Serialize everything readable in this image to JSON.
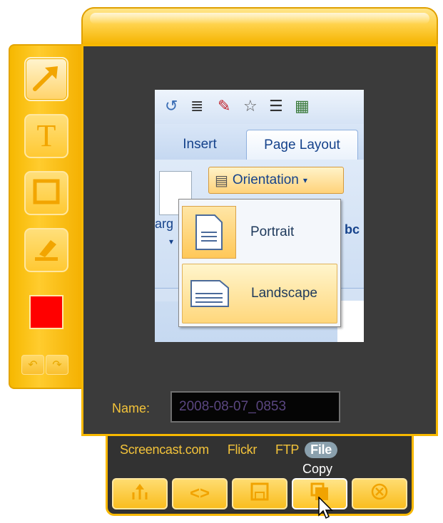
{
  "app": {
    "accent_color": "#f7b800",
    "panel_color": "#3b3b3b"
  },
  "tools": [
    {
      "name": "arrow",
      "icon": "arrow-icon",
      "active": true
    },
    {
      "name": "text",
      "icon": "text-icon",
      "glyph": "T",
      "active": false
    },
    {
      "name": "rectangle",
      "icon": "rectangle-icon",
      "active": false
    },
    {
      "name": "highlight",
      "icon": "highlighter-icon",
      "active": false
    }
  ],
  "current_color": "#ff0000",
  "preview": {
    "tabs": [
      "Insert",
      "Page Layout"
    ],
    "selected_tab": "Page Layout",
    "button_label": "Orientation",
    "partial_label": "arg",
    "partial_label_right": "bc",
    "menu_items": [
      {
        "label": "Portrait",
        "selected": true
      },
      {
        "label": "Landscape",
        "hovered": true
      }
    ]
  },
  "name_field": {
    "label": "Name:",
    "value": "2008-08-07_0853"
  },
  "share_tabs": [
    {
      "label": "Screencast.com",
      "selected": false
    },
    {
      "label": "Flickr",
      "selected": false
    },
    {
      "label": "FTP",
      "selected": false
    },
    {
      "label": "File",
      "selected": true
    }
  ],
  "tooltip": "Copy",
  "actions": [
    {
      "name": "share",
      "icon": "share-icon"
    },
    {
      "name": "embed",
      "icon": "embed-code-icon"
    },
    {
      "name": "save",
      "icon": "save-icon"
    },
    {
      "name": "copy",
      "icon": "copy-icon"
    },
    {
      "name": "close",
      "icon": "close-icon"
    }
  ]
}
